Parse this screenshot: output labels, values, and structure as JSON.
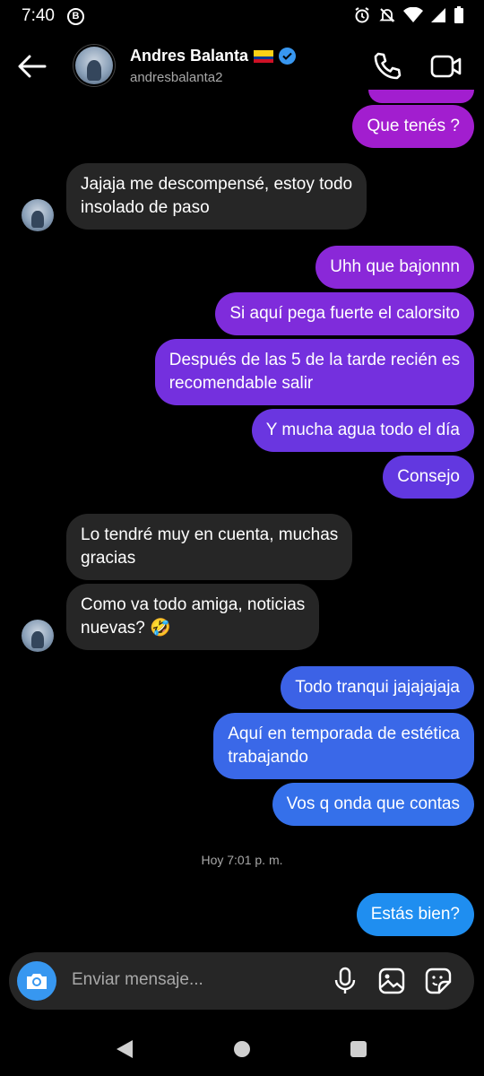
{
  "status_bar": {
    "time": "7:40",
    "badge": "B"
  },
  "header": {
    "name": "Andres Balanta",
    "username": "andresbalanta2",
    "flag_colors": [
      "#fcd116",
      "#003893",
      "#ce1126"
    ],
    "verified_color": "#3897f0"
  },
  "messages": [
    {
      "side": "out",
      "text": "Que tenés ?",
      "color": "#a21ecf"
    },
    {
      "side": "in",
      "text": "Jajaja me descompensé, estoy todo\ninsolado de paso"
    },
    {
      "side": "out",
      "text": "Uhh que bajonnn",
      "color": "#8a28d8"
    },
    {
      "side": "out",
      "text": "Si aquí pega fuerte el calorsito",
      "color": "#7f2cdb"
    },
    {
      "side": "out",
      "text": "Después de las 5 de la tarde recién es\nrecomendable salir",
      "color": "#7430de"
    },
    {
      "side": "out",
      "text": "Y mucha agua todo el día",
      "color": "#6a36e0"
    },
    {
      "side": "out",
      "text": "Consejo",
      "color": "#6238e0"
    },
    {
      "side": "in",
      "text": "Lo tendré muy en cuenta, muchas\ngracias"
    },
    {
      "side": "in",
      "text": "Como va todo amiga, noticias\nnuevas? 🤣"
    },
    {
      "side": "out",
      "text": "Todo tranqui jajajajaja",
      "color": "#3c62e6"
    },
    {
      "side": "out",
      "text": "Aquí en temporada de estética\ntrabajando",
      "color": "#3a68e8"
    },
    {
      "side": "out",
      "text": "Vos q onda que contas",
      "color": "#3570ea"
    },
    {
      "side": "out",
      "text": "Estás bien?",
      "color": "#1f8ef0"
    }
  ],
  "timestamp": "Hoy 7:01 p. m.",
  "composer": {
    "placeholder": "Enviar mensaje..."
  },
  "icons": {
    "back": "arrow-left-icon",
    "call": "phone-icon",
    "video": "video-camera-icon",
    "camera": "camera-icon",
    "mic": "microphone-icon",
    "gallery": "image-icon",
    "sticker": "sticker-icon"
  },
  "accent_color": "#3797f0"
}
